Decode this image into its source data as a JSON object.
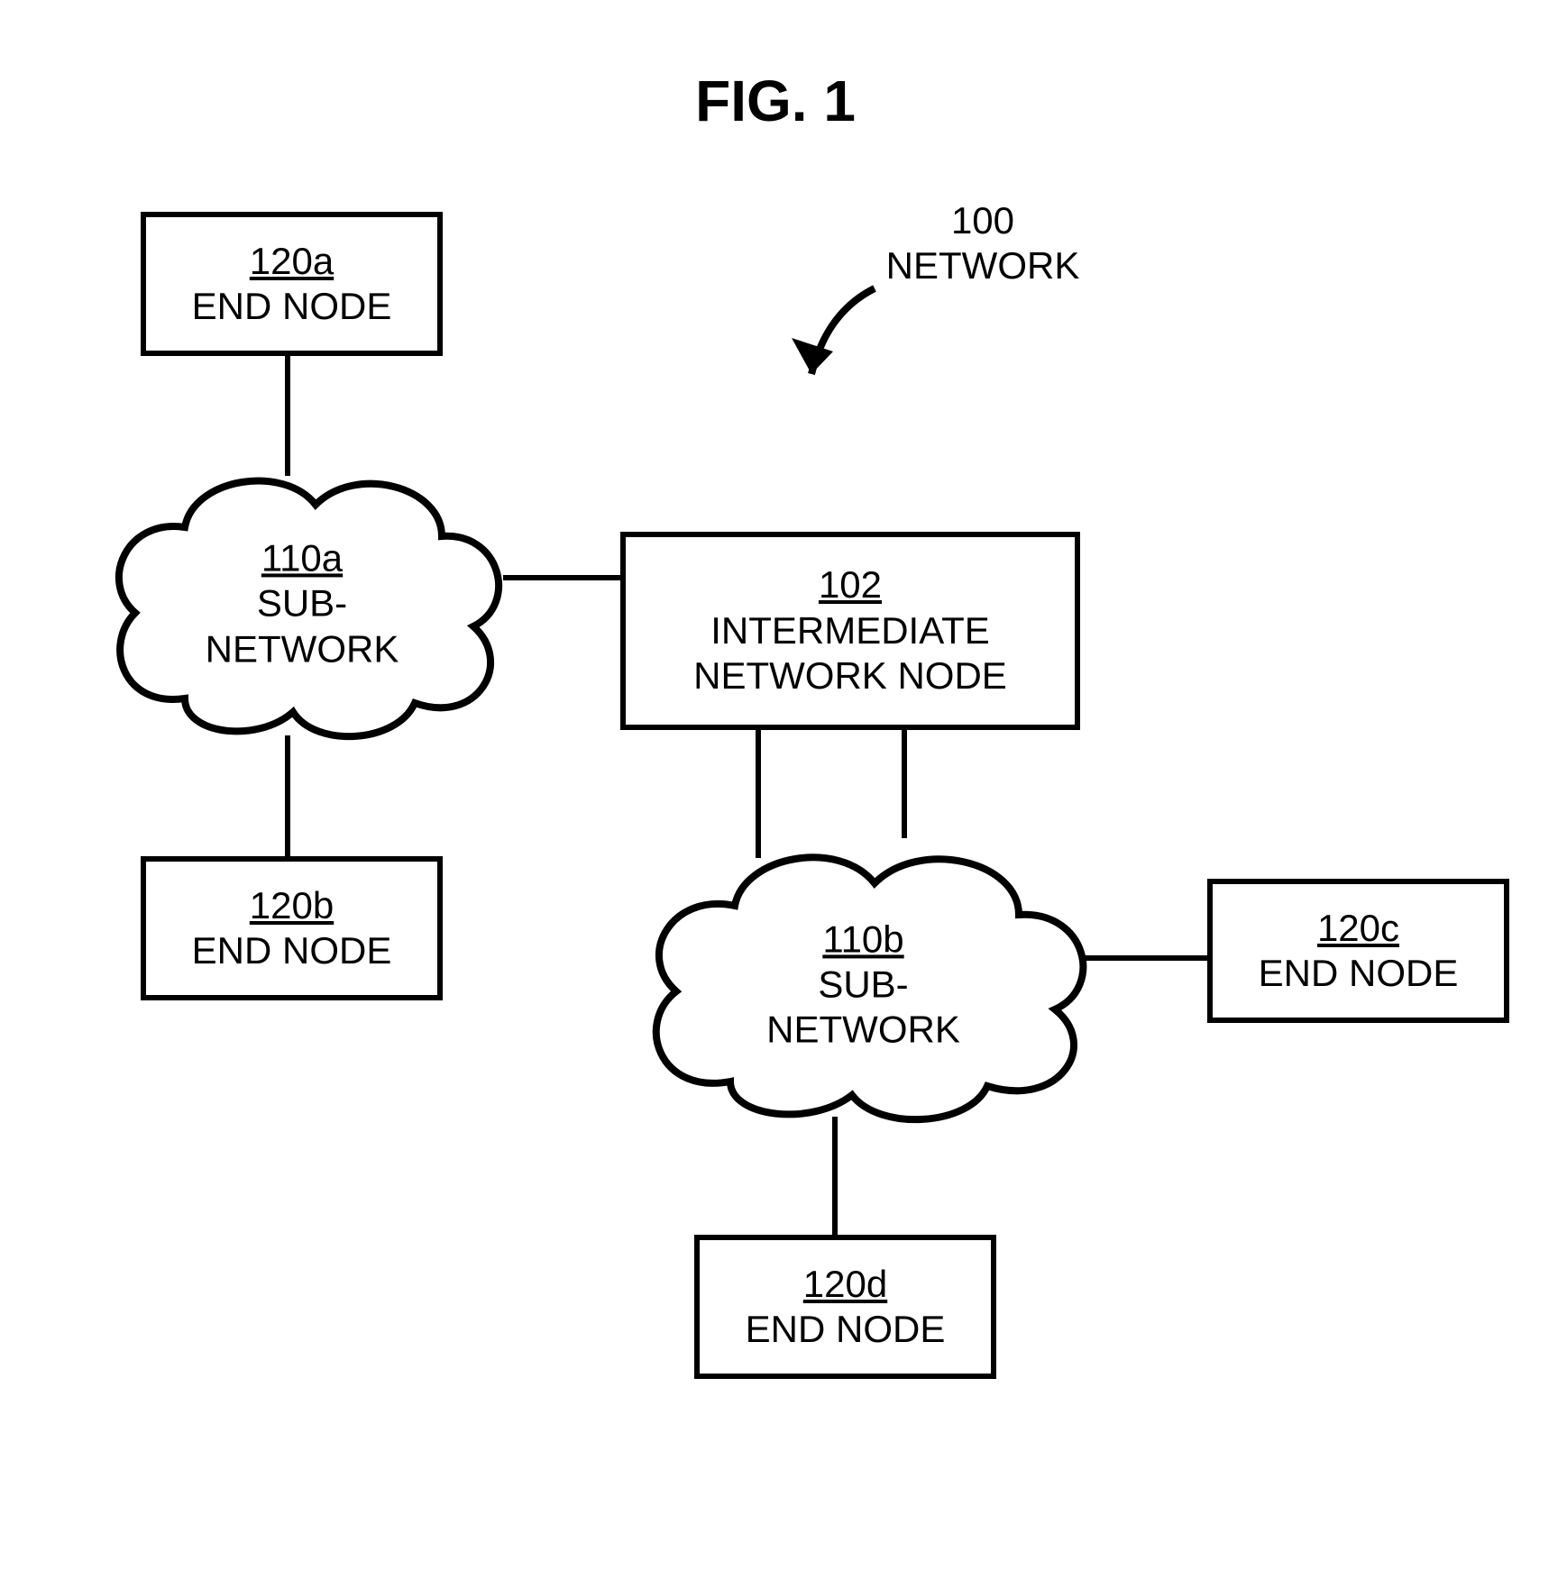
{
  "figure": {
    "title": "FIG. 1",
    "label_ref": "100",
    "label_text": "NETWORK"
  },
  "nodes": {
    "end_120a": {
      "ref": "120a",
      "label": "END NODE"
    },
    "end_120b": {
      "ref": "120b",
      "label": "END NODE"
    },
    "end_120c": {
      "ref": "120c",
      "label": "END NODE"
    },
    "end_120d": {
      "ref": "120d",
      "label": "END NODE"
    },
    "inter_102": {
      "ref": "102",
      "label1": "INTERMEDIATE",
      "label2": "NETWORK NODE"
    }
  },
  "clouds": {
    "sub_110a": {
      "ref": "110a",
      "label": "SUB-NETWORK"
    },
    "sub_110b": {
      "ref": "110b",
      "label": "SUB-NETWORK"
    }
  }
}
